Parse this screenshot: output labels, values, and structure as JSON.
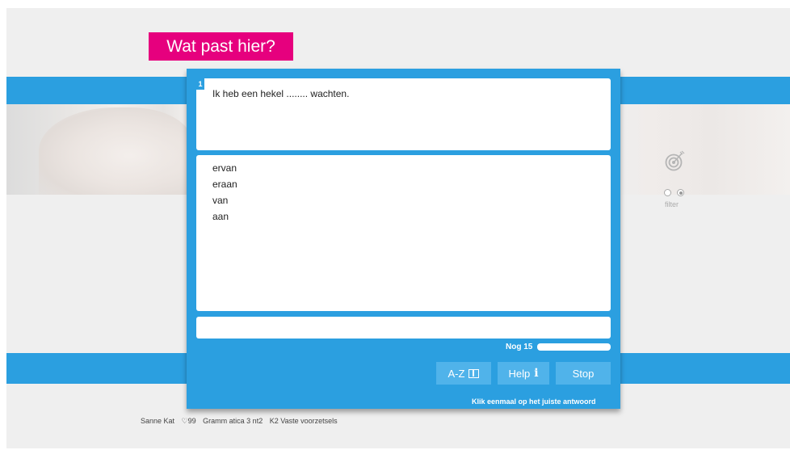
{
  "title": "Wat past hier?",
  "question": {
    "number": "1",
    "text": "Ik heb een hekel ........ wachten."
  },
  "options": [
    "ervan",
    "eraan",
    "van",
    "aan"
  ],
  "answer": {
    "value": ""
  },
  "progress": {
    "label": "Nog 15",
    "remaining": 15
  },
  "buttons": {
    "az": "A-Z",
    "help": "Help",
    "help_icon_char": "i",
    "stop": "Stop"
  },
  "hint": "Klik eenmaal op het juiste antwoord",
  "side": {
    "filter_label": "filter"
  },
  "footer": {
    "user": "Sanne Kat",
    "score": "♡99",
    "course": "Gramm atica 3 nt2",
    "lesson": "K2 Vaste voorzetsels"
  },
  "colors": {
    "accent": "#2b9fe0",
    "title_bg": "#e6007e",
    "button_bg": "#50b3ea"
  }
}
